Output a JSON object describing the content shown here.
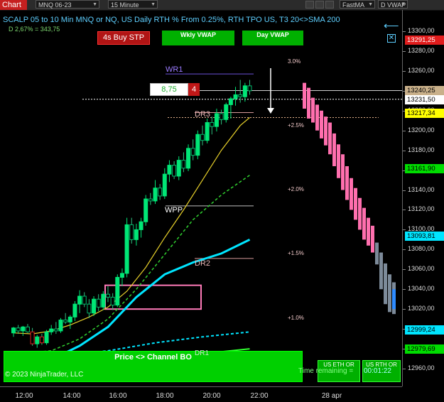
{
  "toolbar": {
    "tab_label": "Chart",
    "instrument": "MNQ 06-23",
    "interval": "15 Minute",
    "indicator_1": "FastMA",
    "indicator_2": "D VWAP"
  },
  "header": {
    "title": "SCALP 05 to 10 Min MNQ or NQ, US Daily RTH % From 0.25%, RTH TPO US, T3 20<>SMA 200",
    "subtitle": "D 2,67% = 343,75"
  },
  "buttons": {
    "buy_stp": "4s  Buy STP",
    "wkly_vwap": "Wkly VWAP",
    "day_vwap": "Day VWAP",
    "entry_price": "8,75",
    "qty": "4"
  },
  "levels": {
    "wr1": "WR1",
    "dr3": "DR3",
    "wpp": "WPP",
    "dr2": "DR2",
    "dr1": "DR1"
  },
  "percent_labels": [
    "3.0%",
    "+2.5%",
    "+2.0%",
    "+1.5%",
    "+1.0%"
  ],
  "bottom": {
    "banner": "Price <> Channel BO",
    "copyright": "© 2023 NinjaTrader, LLC",
    "us_eth_or": "US ETH OR",
    "us_rth_or": "US RTH OR",
    "time_remaining_label": "Time remaining =",
    "time_remaining_value": "00:01:22"
  },
  "price_labels": [
    {
      "text": "13291,25",
      "bg": "#e11d1d",
      "fg": "#ffffff",
      "price": 13291.25
    },
    {
      "text": "13240,25",
      "bg": "#c9b08a",
      "fg": "#000000",
      "price": 13240.25
    },
    {
      "text": "13231,50",
      "bg": "#ffffff",
      "fg": "#000000",
      "price": 13231.5
    },
    {
      "text": "13217,34",
      "bg": "#ffff00",
      "fg": "#000000",
      "price": 13217.34
    },
    {
      "text": "13161,90",
      "bg": "#00dd00",
      "fg": "#000000",
      "price": 13161.9
    },
    {
      "text": "13093,81",
      "bg": "#00e5ff",
      "fg": "#000000",
      "price": 13093.81
    },
    {
      "text": "12999,24",
      "bg": "#00e5ff",
      "fg": "#000000",
      "price": 12999.24
    },
    {
      "text": "12979,69",
      "bg": "#00dd00",
      "fg": "#000000",
      "price": 12979.69
    }
  ],
  "chart_data": {
    "type": "candlestick",
    "instrument": "MNQ 06-23",
    "interval": "15 Minute",
    "x_ticks": [
      "12:00",
      "14:00",
      "16:00",
      "18:00",
      "20:00",
      "22:00",
      "28 apr"
    ],
    "y_ticks": [
      13300,
      13280,
      13260,
      13240,
      13220,
      13200,
      13180,
      13160,
      13140,
      13120,
      13100,
      13080,
      13060,
      13040,
      13020,
      13000,
      12980,
      12960
    ],
    "ylim": [
      12952,
      13305
    ],
    "candles": [
      [
        12996,
        13002,
        12992,
        13001
      ],
      [
        13001,
        13004,
        12995,
        12998
      ],
      [
        12998,
        13003,
        12993,
        13002
      ],
      [
        13002,
        13005,
        12996,
        12997
      ],
      [
        12997,
        13001,
        12983,
        12985
      ],
      [
        12985,
        12994,
        12981,
        12992
      ],
      [
        12992,
        12995,
        12984,
        12986
      ],
      [
        12986,
        12999,
        12984,
        12997
      ],
      [
        12997,
        13004,
        12994,
        13000
      ],
      [
        13000,
        13007,
        12995,
        12998
      ],
      [
        12998,
        13011,
        12996,
        13009
      ],
      [
        13009,
        13016,
        13005,
        13007
      ],
      [
        13007,
        13014,
        13000,
        13012
      ],
      [
        13012,
        13028,
        13008,
        13025
      ],
      [
        13025,
        13039,
        13016,
        13033
      ],
      [
        13033,
        13037,
        13022,
        13025
      ],
      [
        13025,
        13030,
        13011,
        13016
      ],
      [
        13016,
        13033,
        13013,
        13030
      ],
      [
        13030,
        13035,
        13018,
        13022
      ],
      [
        13022,
        13038,
        13019,
        13035
      ],
      [
        13035,
        13043,
        13027,
        13032
      ],
      [
        13032,
        13036,
        13019,
        13024
      ],
      [
        13024,
        13055,
        13022,
        13052
      ],
      [
        13052,
        13061,
        13043,
        13056
      ],
      [
        13056,
        13112,
        13052,
        13105
      ],
      [
        13105,
        13112,
        13086,
        13090
      ],
      [
        13090,
        13106,
        13084,
        13100
      ],
      [
        13100,
        13112,
        13092,
        13108
      ],
      [
        13108,
        13135,
        13104,
        13131
      ],
      [
        13131,
        13137,
        13125,
        13129
      ],
      [
        13129,
        13150,
        13126,
        13142
      ],
      [
        13142,
        13146,
        13130,
        13134
      ],
      [
        13134,
        13162,
        13131,
        13156
      ],
      [
        13156,
        13170,
        13148,
        13165
      ],
      [
        13165,
        13169,
        13151,
        13154
      ],
      [
        13154,
        13174,
        13150,
        13170
      ],
      [
        13170,
        13178,
        13158,
        13162
      ],
      [
        13162,
        13186,
        13159,
        13182
      ],
      [
        13182,
        13191,
        13170,
        13175
      ],
      [
        13175,
        13200,
        13171,
        13196
      ],
      [
        13196,
        13205,
        13185,
        13190
      ],
      [
        13190,
        13212,
        13187,
        13208
      ],
      [
        13208,
        13214,
        13196,
        13204
      ],
      [
        13204,
        13222,
        13199,
        13217
      ],
      [
        13217,
        13221,
        13206,
        13211
      ],
      [
        13211,
        13228,
        13208,
        13226
      ],
      [
        13226,
        13234,
        13212,
        13232
      ],
      [
        13232,
        13244,
        13225,
        13236
      ],
      [
        13236,
        13251,
        13228,
        13234
      ],
      [
        13234,
        13248,
        13229,
        13245
      ],
      [
        13245,
        13251,
        13236,
        13240
      ]
    ],
    "tpo_columns": [
      [
        13248,
        13222
      ],
      [
        13243,
        13212
      ],
      [
        13233,
        13208
      ],
      [
        13226,
        13200
      ],
      [
        13220,
        13192
      ],
      [
        13214,
        13185
      ],
      [
        13208,
        13176
      ],
      [
        13197,
        13164
      ],
      [
        13186,
        13152
      ],
      [
        13176,
        13140
      ],
      [
        13164,
        13130
      ],
      [
        13152,
        13120
      ],
      [
        13142,
        13110
      ],
      [
        13132,
        13100
      ],
      [
        13122,
        13090
      ],
      [
        13112,
        13084
      ],
      [
        13104,
        13077
      ]
    ],
    "tpo_grey_columns": [
      [
        13087,
        13065
      ],
      [
        13077,
        13040
      ],
      [
        13066,
        13025
      ],
      [
        13055,
        13017
      ],
      [
        13047,
        13015
      ]
    ],
    "fast_ma": [
      [
        0,
        12996
      ],
      [
        4,
        12995
      ],
      [
        8,
        12998
      ],
      [
        12,
        13004
      ],
      [
        16,
        13012
      ],
      [
        20,
        13022
      ],
      [
        24,
        13038
      ],
      [
        28,
        13062
      ],
      [
        32,
        13092
      ],
      [
        36,
        13120
      ],
      [
        40,
        13150
      ],
      [
        44,
        13180
      ],
      [
        48,
        13205
      ],
      [
        50,
        13213
      ]
    ],
    "dashed_green": [
      [
        0,
        12975
      ],
      [
        8,
        12978
      ],
      [
        14,
        12990
      ],
      [
        20,
        13010
      ],
      [
        26,
        13040
      ],
      [
        32,
        13075
      ],
      [
        38,
        13110
      ],
      [
        44,
        13135
      ],
      [
        50,
        13155
      ]
    ],
    "cyan_solid": [
      [
        0,
        12967
      ],
      [
        8,
        12969
      ],
      [
        14,
        12983
      ],
      [
        20,
        13002
      ],
      [
        26,
        13032
      ],
      [
        32,
        13055
      ],
      [
        38,
        13067
      ],
      [
        44,
        13076
      ],
      [
        50,
        13090
      ]
    ],
    "cyan_dashed": [
      [
        0,
        12972
      ],
      [
        10,
        12973
      ],
      [
        20,
        12978
      ],
      [
        30,
        12986
      ],
      [
        40,
        12992
      ],
      [
        50,
        12997
      ]
    ],
    "green_solid": [
      [
        0,
        12968
      ],
      [
        10,
        12969
      ],
      [
        20,
        12970
      ],
      [
        30,
        12972
      ],
      [
        40,
        12975
      ],
      [
        50,
        12980
      ]
    ],
    "levels": {
      "WR1": 13257,
      "DR3": 13218,
      "WPP": 13124,
      "DR2": 13071,
      "DR1": 12979
    },
    "day_high_dotted": 13231.5,
    "dr3_dotted": 13213,
    "box": [
      13044,
      13020
    ]
  }
}
